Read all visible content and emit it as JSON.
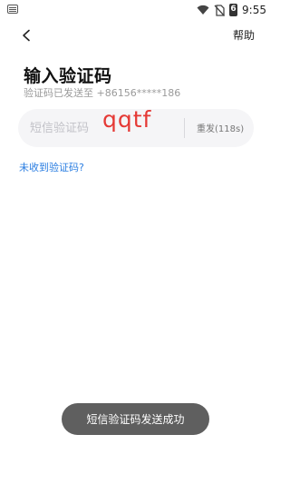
{
  "status_bar": {
    "time": "9:55",
    "battery_level_text": "6",
    "icons": [
      "keyboard-icon",
      "wifi-icon",
      "no-sim-icon",
      "battery-icon"
    ]
  },
  "header": {
    "back_icon": "chevron-left-icon",
    "help_label": "帮助"
  },
  "main": {
    "title": "输入验证码",
    "subtitle": "验证码已发送至 +86156*****186",
    "code_input": {
      "placeholder": "短信验证码",
      "handwritten_value": "qqtf"
    },
    "resend_label": "重发(118s)",
    "no_code_link": "未收到验证码?"
  },
  "toast": {
    "message": "短信验证码发送成功"
  },
  "colors": {
    "link": "#2a7de1",
    "annotation": "#e53935",
    "toast_bg": "#5f5f5f",
    "input_bg": "#f5f5f7"
  }
}
